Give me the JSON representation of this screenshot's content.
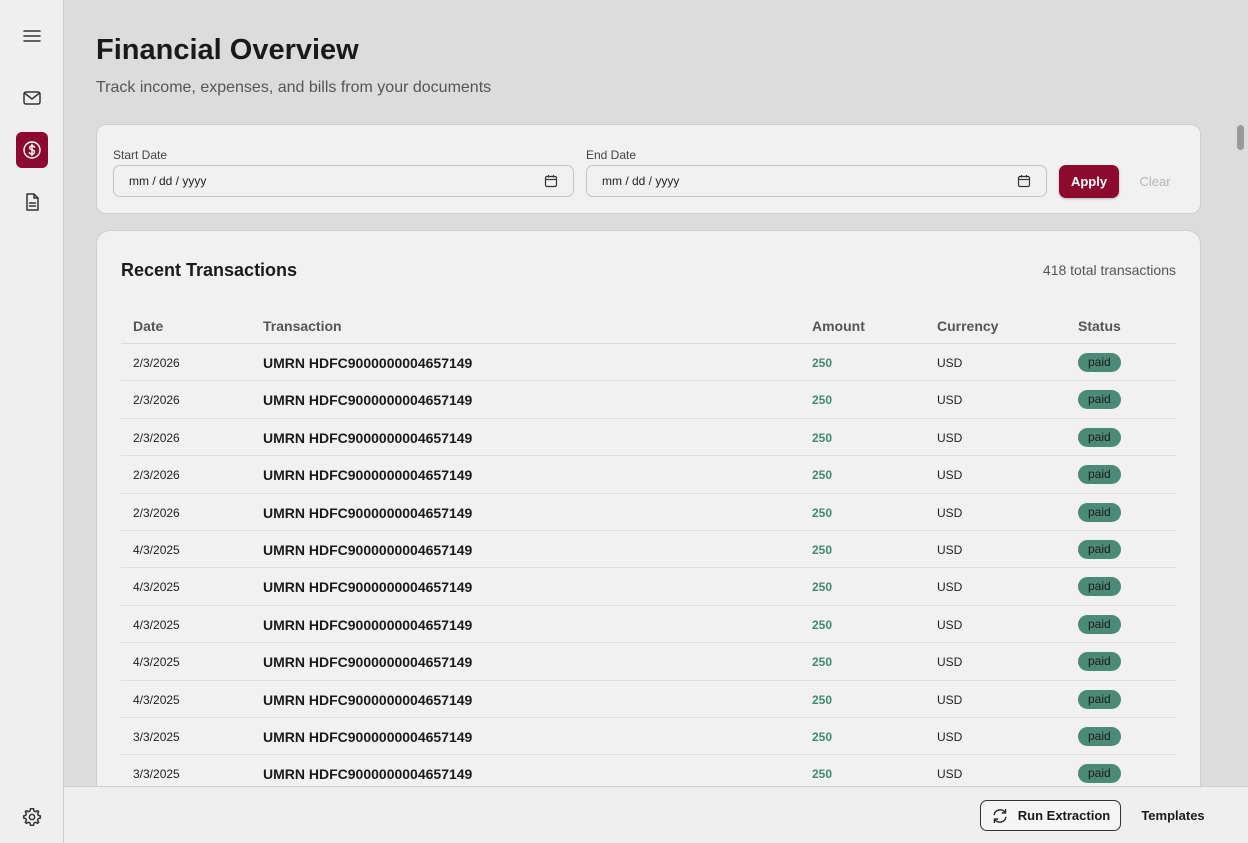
{
  "sidebar": {
    "items": [
      {
        "icon": "menu-icon"
      },
      {
        "icon": "mail-icon"
      },
      {
        "icon": "dollar-icon",
        "active": true
      },
      {
        "icon": "document-icon"
      },
      {
        "icon": "gear-icon"
      }
    ]
  },
  "header": {
    "title": "Financial Overview",
    "subtitle": "Track income, expenses, and bills from your documents"
  },
  "filters": {
    "start_label": "Start Date",
    "start_value": "mm / dd / yyyy",
    "end_label": "End Date",
    "end_value": "mm / dd / yyyy",
    "apply_label": "Apply",
    "clear_label": "Clear"
  },
  "transactions": {
    "title": "Recent Transactions",
    "count_text": "418 total transactions",
    "columns": [
      "Date",
      "Transaction",
      "Amount",
      "Currency",
      "Status"
    ],
    "rows": [
      {
        "date": "2/3/2026",
        "transaction": "UMRN HDFC9000000004657149",
        "amount": "250",
        "currency": "USD",
        "status": "paid"
      },
      {
        "date": "2/3/2026",
        "transaction": "UMRN HDFC9000000004657149",
        "amount": "250",
        "currency": "USD",
        "status": "paid"
      },
      {
        "date": "2/3/2026",
        "transaction": "UMRN HDFC9000000004657149",
        "amount": "250",
        "currency": "USD",
        "status": "paid"
      },
      {
        "date": "2/3/2026",
        "transaction": "UMRN HDFC9000000004657149",
        "amount": "250",
        "currency": "USD",
        "status": "paid"
      },
      {
        "date": "2/3/2026",
        "transaction": "UMRN HDFC9000000004657149",
        "amount": "250",
        "currency": "USD",
        "status": "paid"
      },
      {
        "date": "4/3/2025",
        "transaction": "UMRN HDFC9000000004657149",
        "amount": "250",
        "currency": "USD",
        "status": "paid"
      },
      {
        "date": "4/3/2025",
        "transaction": "UMRN HDFC9000000004657149",
        "amount": "250",
        "currency": "USD",
        "status": "paid"
      },
      {
        "date": "4/3/2025",
        "transaction": "UMRN HDFC9000000004657149",
        "amount": "250",
        "currency": "USD",
        "status": "paid"
      },
      {
        "date": "4/3/2025",
        "transaction": "UMRN HDFC9000000004657149",
        "amount": "250",
        "currency": "USD",
        "status": "paid"
      },
      {
        "date": "4/3/2025",
        "transaction": "UMRN HDFC9000000004657149",
        "amount": "250",
        "currency": "USD",
        "status": "paid"
      },
      {
        "date": "3/3/2025",
        "transaction": "UMRN HDFC9000000004657149",
        "amount": "250",
        "currency": "USD",
        "status": "paid"
      },
      {
        "date": "3/3/2025",
        "transaction": "UMRN HDFC9000000004657149",
        "amount": "250",
        "currency": "USD",
        "status": "paid"
      }
    ]
  },
  "footer": {
    "run_label": "Run Extraction",
    "templates_label": "Templates"
  },
  "colors": {
    "accent": "#8b0a2e",
    "amount": "#3f8a72",
    "badge": "#4c8a78"
  }
}
